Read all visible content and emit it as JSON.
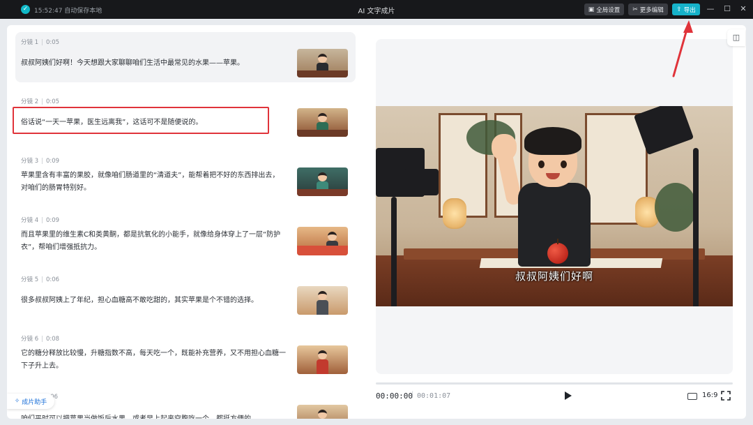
{
  "titlebar": {
    "save_check_icon": "check-circle-icon",
    "save_status": "15:52:47 自动保存本地",
    "title": "AI 文字成片",
    "global_settings": "全局设置",
    "more_edit": "更多编辑",
    "export": "导出"
  },
  "shots": [
    {
      "label": "分镜 1",
      "duration": "0:05",
      "text": "叔叔阿姨们好啊！今天想跟大家聊聊咱们生活中最常见的水果——苹果。"
    },
    {
      "label": "分镜 2",
      "duration": "0:05",
      "text": "俗话说“一天一苹果，医生远离我”，这话可不是随便说的。"
    },
    {
      "label": "分镜 3",
      "duration": "0:09",
      "text": "苹果里含有丰富的果胶，就像咱们肠道里的“清道夫”，能帮着把不好的东西排出去，对咱们的肠胃特别好。"
    },
    {
      "label": "分镜 4",
      "duration": "0:09",
      "text": "而且苹果里的维生素C和类黄酮，都是抗氧化的小能手，就像给身体穿上了一层“防护衣”，帮咱们增强抵抗力。"
    },
    {
      "label": "分镜 5",
      "duration": "0:06",
      "text": "很多叔叔阿姨上了年纪，担心血糖高不敢吃甜的，其实苹果是个不错的选择。"
    },
    {
      "label": "分镜 6",
      "duration": "0:08",
      "text": "它的糖分释放比较慢，升糖指数不高，每天吃一个，既能补充营养，又不用担心血糖一下子升上去。"
    },
    {
      "label": "",
      "duration": "0:06",
      "text": "咱们平时可以把苹果当做饭后水果，或者早上起来空腹吃一个，都挺方便的。"
    }
  ],
  "assistant": {
    "label": "成片助手",
    "icon": "sparkle-icon"
  },
  "preview": {
    "subtitle": "叔叔阿姨们好啊",
    "current_time": "00:00:00",
    "separator": "|",
    "duration": "00:01:07",
    "ratio": "16:9"
  },
  "colors": {
    "accent": "#16b2c9",
    "annotation": "#e0333a",
    "titlebar_bg": "#17181b"
  }
}
